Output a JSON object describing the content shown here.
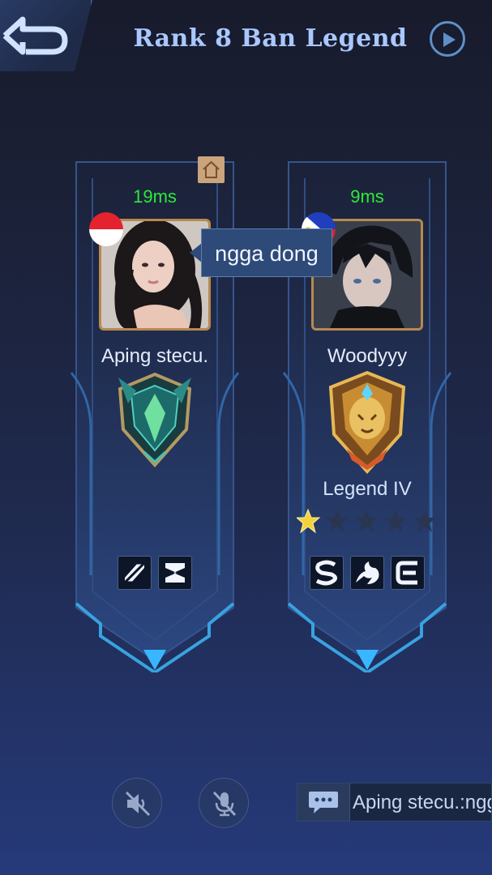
{
  "header": {
    "title": "Rank 8 Ban Legend",
    "back_icon": "back-arrow-icon",
    "play_icon": "play-circle-icon"
  },
  "players": [
    {
      "ping": "19ms",
      "name": "Aping stecu.",
      "flag": "indonesia-flag-icon",
      "rank_label": "",
      "rank_icon": "mythic-emblem-icon",
      "spells": [
        "spell-z-icon",
        "spell-z-alt-icon"
      ]
    },
    {
      "ping": "9ms",
      "name": "Woodyyy",
      "flag": "philippines-flag-icon",
      "rank_label": "Legend IV",
      "rank_icon": "legend-emblem-icon",
      "stars_filled": 1,
      "stars_total": 5,
      "spells": [
        "spell-s-icon",
        "spell-flame-icon",
        "spell-e-icon"
      ]
    }
  ],
  "chat_bubble": {
    "text": "ngga dong"
  },
  "chat_bar": {
    "text": "Aping stecu.:ngga dong"
  },
  "colors": {
    "ping": "#2ee83a",
    "title": "#a9c8ff",
    "frame": "#3d7fc8",
    "avatar_border": "#b7894f"
  }
}
